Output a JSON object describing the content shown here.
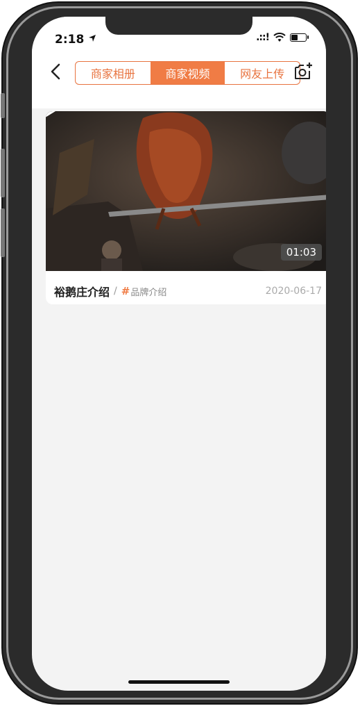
{
  "status_bar": {
    "time": "2:18",
    "signal": ".::!"
  },
  "tabs": [
    {
      "label": "商家相册",
      "active": false
    },
    {
      "label": "商家视频",
      "active": true
    },
    {
      "label": "网友上传",
      "active": false
    }
  ],
  "video_card": {
    "duration": "01:03",
    "title": "裕鹅庄介绍",
    "separator": "/",
    "hash": "#",
    "tag": "品牌介绍",
    "date": "2020-06-17"
  },
  "accent_color": "#f07c45",
  "battery_level": 0.5,
  "icons": [
    "back-chevron-icon",
    "add-photo-icon",
    "play-icon",
    "wifi-icon",
    "battery-icon",
    "location-arrow-icon"
  ]
}
